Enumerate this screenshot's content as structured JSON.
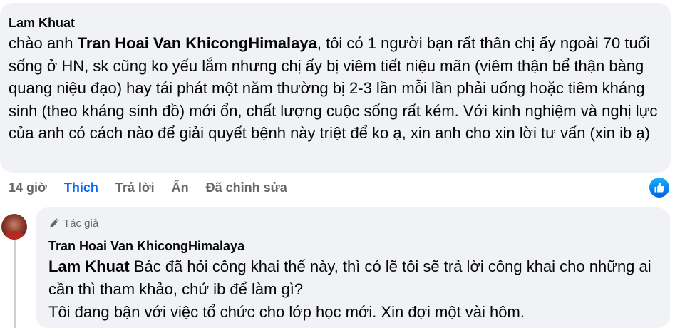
{
  "comment1": {
    "author": "Lam Khuat",
    "prefix": "chào anh ",
    "mention": "Tran Hoai Van KhicongHimalaya",
    "text": ", tôi có 1 người bạn rất thân chị ấy ngoài 70 tuổi sống ở HN, sk cũng ko yếu lắm nhưng chị ấy bị viêm tiết niệu mãn (viêm thận bể thận bàng quang niệu đạo) hay tái phát một năm thường bị 2-3 lần mỗi lần phải uống hoặc tiêm kháng sinh (theo kháng sinh đồ) mới ổn, chất lượng cuộc sống rất kém. Với kinh nghiệm và nghị lực của anh có cách nào để giải quyết bệnh này triệt để ko ạ, xin anh cho xin lời tư vấn (xin ib ạ)",
    "actions": {
      "time": "14 giờ",
      "like": "Thích",
      "reply": "Trả lời",
      "hide": "Ẩn",
      "edited": "Đã chỉnh sửa"
    }
  },
  "reply": {
    "badge": "Tác giả",
    "author": "Tran Hoai Van KhicongHimalaya",
    "mention": "Lam Khuat",
    "text": " Bác đã hỏi công khai thế này, thì có lẽ tôi sẽ trả lời công khai cho những ai cần thì tham khảo, chứ ib để làm gì?",
    "text2": "Tôi đang bận với việc tổ chức cho lớp học mới. Xin đợi một vài hôm."
  },
  "colors": {
    "bubble": "#f0f2f5",
    "accent": "#0866ff",
    "muted": "#65676b"
  },
  "icons": {
    "like_reaction": "thumbs-up-icon",
    "author_badge": "pencil-icon"
  }
}
